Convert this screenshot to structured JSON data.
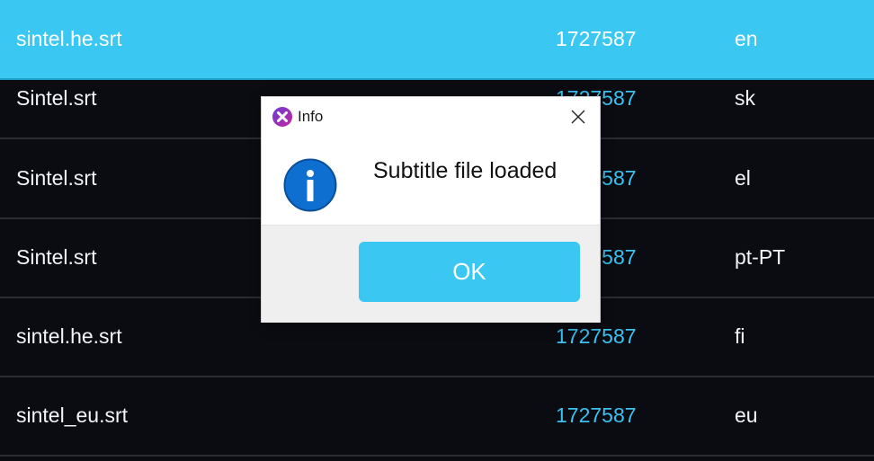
{
  "rows": [
    {
      "name": "sintel.he.srt",
      "id": "1727587",
      "lang": "en",
      "selected": true
    },
    {
      "name": "Sintel.srt",
      "id": "1727587",
      "lang": "sk",
      "selected": false
    },
    {
      "name": "Sintel.srt",
      "id": "1727587",
      "lang": "el",
      "selected": false
    },
    {
      "name": "Sintel.srt",
      "id": "1727587",
      "lang": "pt-PT",
      "selected": false
    },
    {
      "name": "sintel.he.srt",
      "id": "1727587",
      "lang": "fi",
      "selected": false
    },
    {
      "name": "sintel_eu.srt",
      "id": "1727587",
      "lang": "eu",
      "selected": false
    }
  ],
  "dialog": {
    "title": "Info",
    "message": "Subtitle file loaded",
    "ok_label": "OK",
    "icons": {
      "app": "app-logo-icon",
      "info": "info-icon",
      "close": "close-icon"
    }
  },
  "colors": {
    "background": "#0b0c12",
    "accent": "#3ac8f2",
    "id_text": "#3bc2f0",
    "row_divider": "#2b2d35"
  }
}
